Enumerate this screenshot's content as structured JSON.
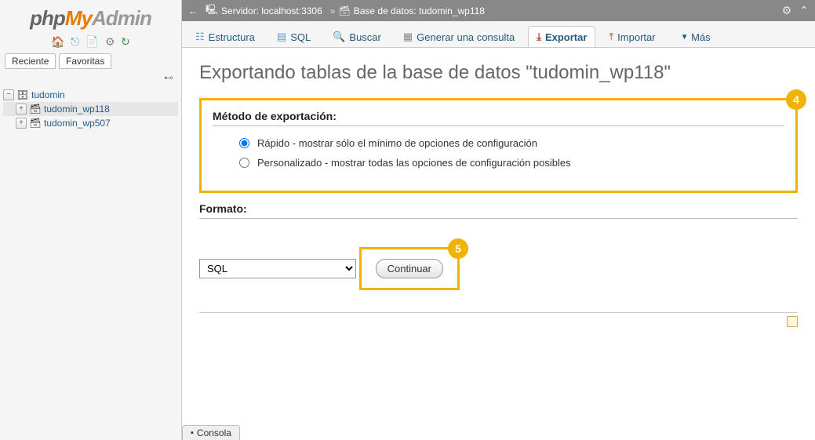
{
  "logo": {
    "php": "php",
    "my": "My",
    "admin": "Admin"
  },
  "sidebar_tabs": {
    "recent": "Reciente",
    "favorites": "Favoritas"
  },
  "tree": {
    "root": "tudomin",
    "db1": "tudomin_wp118",
    "db2": "tudomin_wp507"
  },
  "breadcrumb": {
    "server_label": "Servidor:",
    "server_value": "localhost:3306",
    "db_label": "Base de datos:",
    "db_value": "tudomin_wp118"
  },
  "tabs": {
    "structure": "Estructura",
    "sql": "SQL",
    "search": "Buscar",
    "query": "Generar una consulta",
    "export": "Exportar",
    "import": "Importar",
    "more": "Más"
  },
  "heading": "Exportando tablas de la base de datos \"tudomin_wp118\"",
  "method": {
    "title": "Método de exportación:",
    "quick": "Rápido - mostrar sólo el mínimo de opciones de configuración",
    "custom": "Personalizado - mostrar todas las opciones de configuración posibles"
  },
  "format": {
    "title": "Formato:",
    "selected": "SQL"
  },
  "continue": "Continuar",
  "badges": {
    "method": "4",
    "continue": "5"
  },
  "console": "Consola"
}
